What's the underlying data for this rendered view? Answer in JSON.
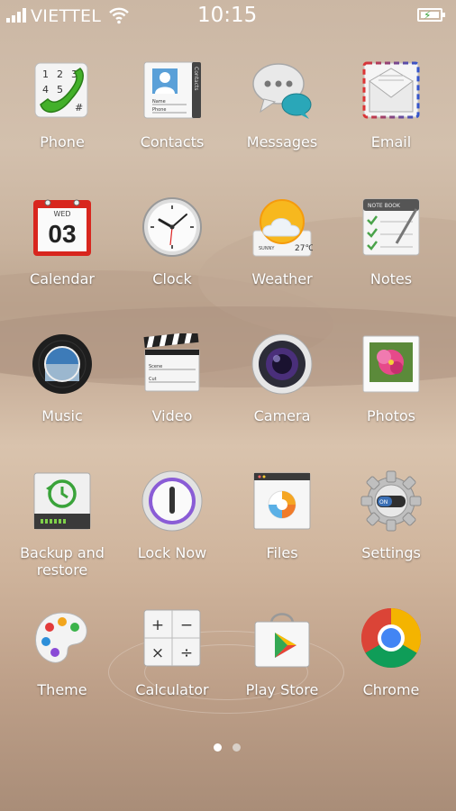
{
  "status_bar": {
    "carrier": "VIETTEL",
    "time": "10:15",
    "icons": [
      "signal-icon",
      "wifi-icon",
      "battery-charging-icon"
    ]
  },
  "apps": [
    {
      "label": "Phone",
      "icon": "phone-icon"
    },
    {
      "label": "Contacts",
      "icon": "contacts-icon"
    },
    {
      "label": "Messages",
      "icon": "messages-icon"
    },
    {
      "label": "Email",
      "icon": "email-icon"
    },
    {
      "label": "Calendar",
      "icon": "calendar-icon"
    },
    {
      "label": "Clock",
      "icon": "clock-icon"
    },
    {
      "label": "Weather",
      "icon": "weather-icon"
    },
    {
      "label": "Notes",
      "icon": "notes-icon"
    },
    {
      "label": "Music",
      "icon": "music-icon"
    },
    {
      "label": "Video",
      "icon": "video-icon"
    },
    {
      "label": "Camera",
      "icon": "camera-icon"
    },
    {
      "label": "Photos",
      "icon": "photos-icon"
    },
    {
      "label": "Backup and restore",
      "icon": "backup-icon"
    },
    {
      "label": "Lock Now",
      "icon": "lock-icon"
    },
    {
      "label": "Files",
      "icon": "files-icon"
    },
    {
      "label": "Settings",
      "icon": "settings-icon"
    },
    {
      "label": "Theme",
      "icon": "theme-icon"
    },
    {
      "label": "Calculator",
      "icon": "calculator-icon"
    },
    {
      "label": "Play Store",
      "icon": "play-store-icon"
    },
    {
      "label": "Chrome",
      "icon": "chrome-icon"
    }
  ],
  "icon_text": {
    "phone_keys": [
      "1",
      "2",
      "3",
      "4",
      "5",
      "#"
    ],
    "contacts_tab": "Contacts",
    "contacts_fields": [
      "Name",
      "Phone"
    ],
    "calendar_day": "WED",
    "calendar_date": "03",
    "weather_city": "SUNNY",
    "weather_temp": "27℃",
    "notes_header": "NOTE BOOK",
    "video_fields": [
      "Scene",
      "Cut"
    ],
    "settings_toggle": "ON",
    "calc_keys": [
      "+",
      "−",
      "×",
      "÷"
    ]
  },
  "pager": {
    "pages": 2,
    "current": 1
  },
  "colors": {
    "label": "#ffffff",
    "dot_active": "#ffffff",
    "dot_inactive": "#d8d0c8"
  }
}
